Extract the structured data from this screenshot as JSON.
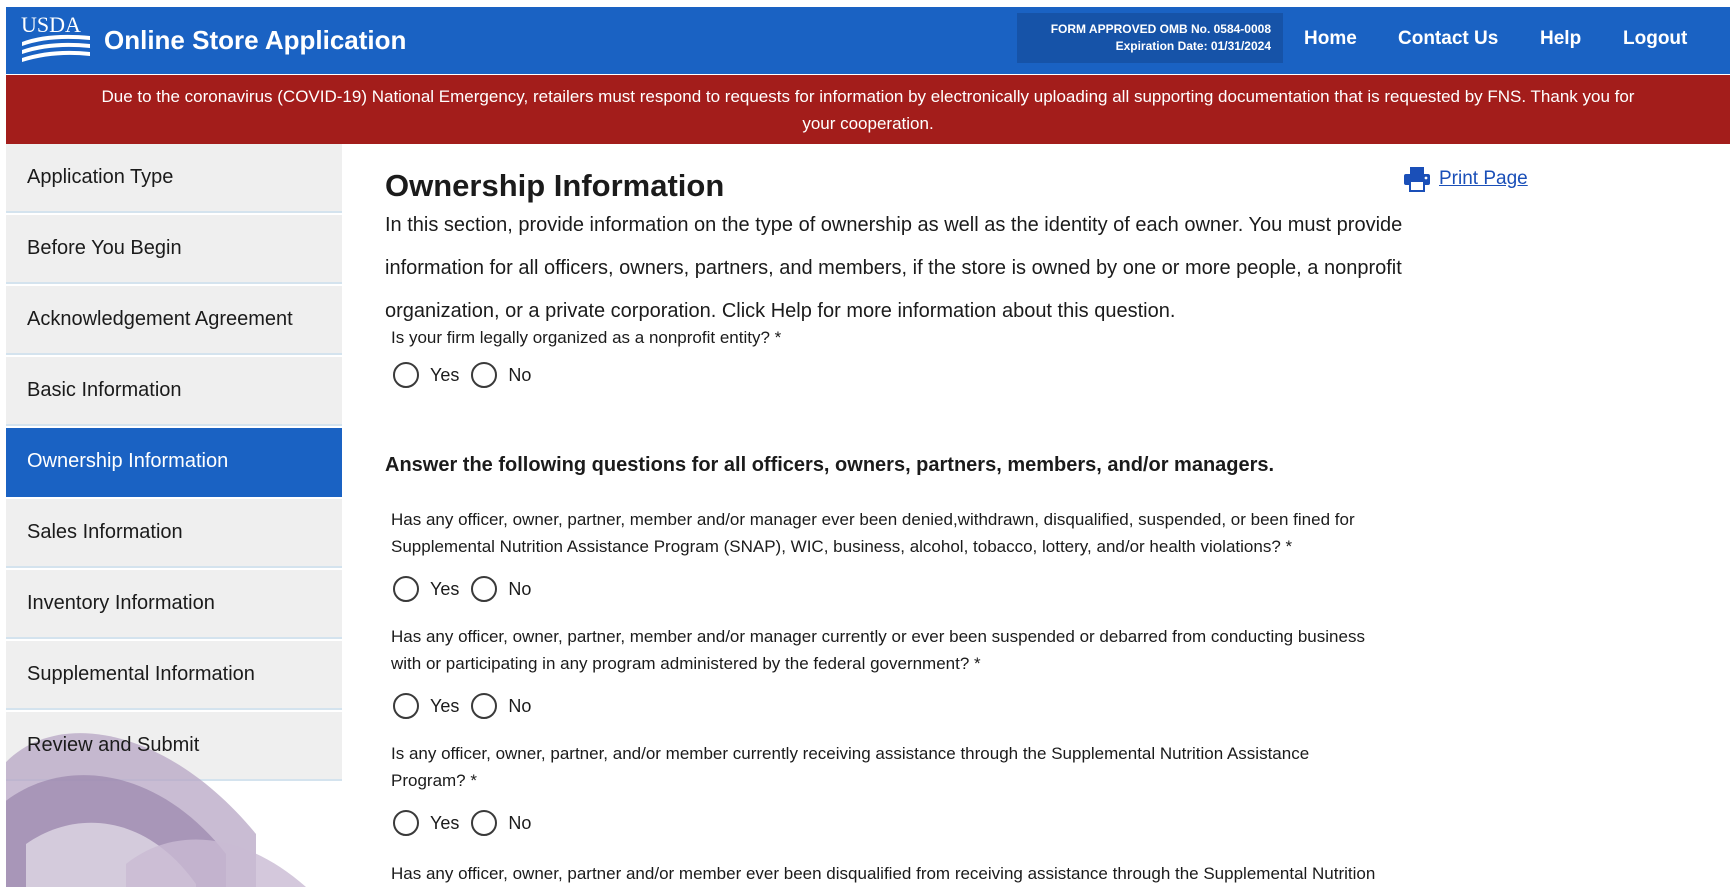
{
  "header": {
    "logo_text": "USDA",
    "title": "Online Store Application",
    "omb_line1": "FORM APPROVED OMB No. 0584-0008",
    "omb_line2": "Expiration Date: 01/31/2024",
    "nav": [
      {
        "label": "Home"
      },
      {
        "label": "Contact Us"
      },
      {
        "label": "Help"
      },
      {
        "label": "Logout"
      }
    ]
  },
  "banner": {
    "line1": "Due to the coronavirus (COVID-19) National Emergency, retailers must respond to requests for information by electronically uploading all supporting documentation that is requested by FNS. Thank you for",
    "line2": "your cooperation."
  },
  "sidebar": {
    "items": [
      {
        "label": "Application Type"
      },
      {
        "label": "Before You Begin"
      },
      {
        "label": "Acknowledgement Agreement"
      },
      {
        "label": "Basic Information"
      },
      {
        "label": "Ownership Information",
        "active": true
      },
      {
        "label": "Sales Information"
      },
      {
        "label": "Inventory Information"
      },
      {
        "label": "Supplemental Information"
      },
      {
        "label": "Review and Submit"
      }
    ]
  },
  "main": {
    "title": "Ownership Information",
    "print_label": "Print Page",
    "intro_lines": [
      "In this section, provide information on the type of ownership as well as the identity of each owner. You must provide",
      "information for all officers, owners, partners, and members, if the store is owned by one or more people, a nonprofit",
      "organization, or a private corporation. Click Help for more information about this question."
    ],
    "q_nonprofit": "Is your firm legally organized as a nonprofit entity? *",
    "section_heading": "Answer the following questions for all officers, owners, partners, members, and/or managers.",
    "questions": [
      {
        "lines": [
          "Has any officer, owner, partner, member and/or manager ever been denied,withdrawn, disqualified, suspended, or been fined for",
          "Supplemental Nutrition Assistance Program (SNAP), WIC, business, alcohol, tobacco, lottery, and/or health violations? *"
        ]
      },
      {
        "lines": [
          "Has any officer, owner, partner, member and/or manager currently or ever been suspended or debarred from conducting business",
          "with or participating in any program administered by the federal government? *"
        ]
      },
      {
        "lines": [
          "Is any officer, owner, partner, and/or member currently receiving assistance through the Supplemental Nutrition Assistance",
          "Program? *"
        ]
      },
      {
        "lines": [
          "Has any officer, owner, partner and/or member ever been disqualified from receiving assistance through the Supplemental Nutrition"
        ]
      }
    ],
    "yes_label": "Yes",
    "no_label": "No"
  },
  "colors": {
    "header_blue": "#1a62c3",
    "banner_red": "#a31d1b",
    "active_nav": "#1a62c3",
    "link_blue": "#1a4fb8"
  },
  "icons": [
    "usda-logo",
    "printer-icon",
    "radio-button"
  ]
}
